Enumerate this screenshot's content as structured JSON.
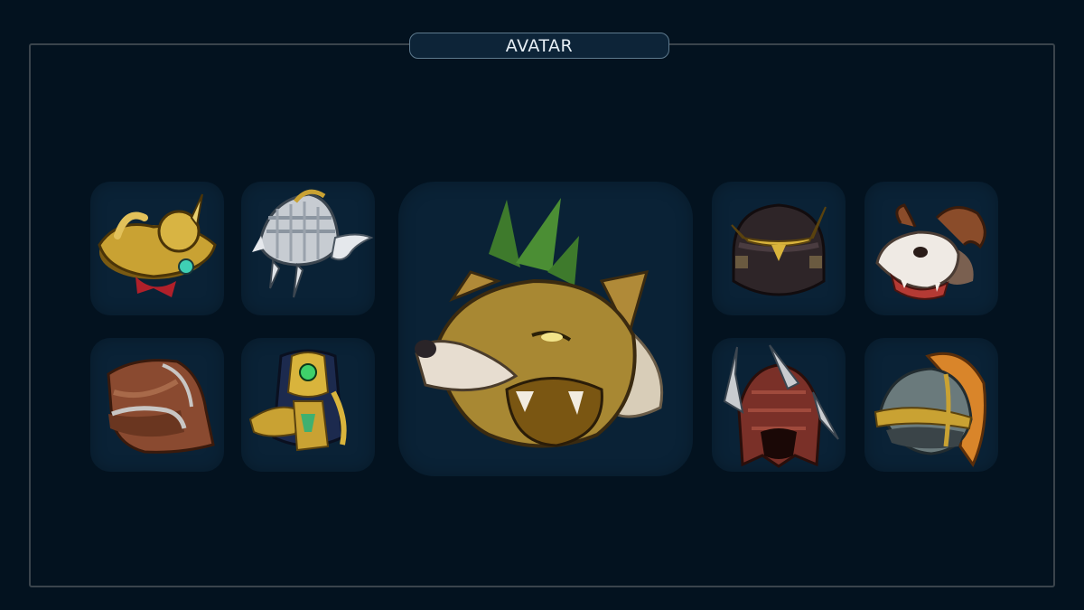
{
  "header": {
    "title": "AVATAR"
  },
  "avatars": [
    {
      "id": "golden-dragon-helm",
      "icon": "golden-dragon-helm-icon"
    },
    {
      "id": "winged-silver-helm",
      "icon": "winged-silver-helm-icon"
    },
    {
      "id": "wolf-head",
      "icon": "wolf-head-icon",
      "featured": true
    },
    {
      "id": "samurai-helm",
      "icon": "samurai-helm-icon"
    },
    {
      "id": "ram-skull",
      "icon": "ram-skull-icon"
    },
    {
      "id": "leather-hood",
      "icon": "leather-hood-icon"
    },
    {
      "id": "pharaoh-helm",
      "icon": "pharaoh-helm-icon"
    },
    {
      "id": "spiked-beast-helm",
      "icon": "spiked-beast-helm-icon"
    },
    {
      "id": "plumed-knight-helm",
      "icon": "plumed-knight-helm-icon"
    }
  ],
  "colors": {
    "background": "#03121f",
    "tile": "#0a2236",
    "frame": "#3a444c",
    "pill": "#0d2438",
    "pill_border": "#5e7a8e",
    "gold": "#c9a233",
    "silver": "#c7ccd2"
  }
}
